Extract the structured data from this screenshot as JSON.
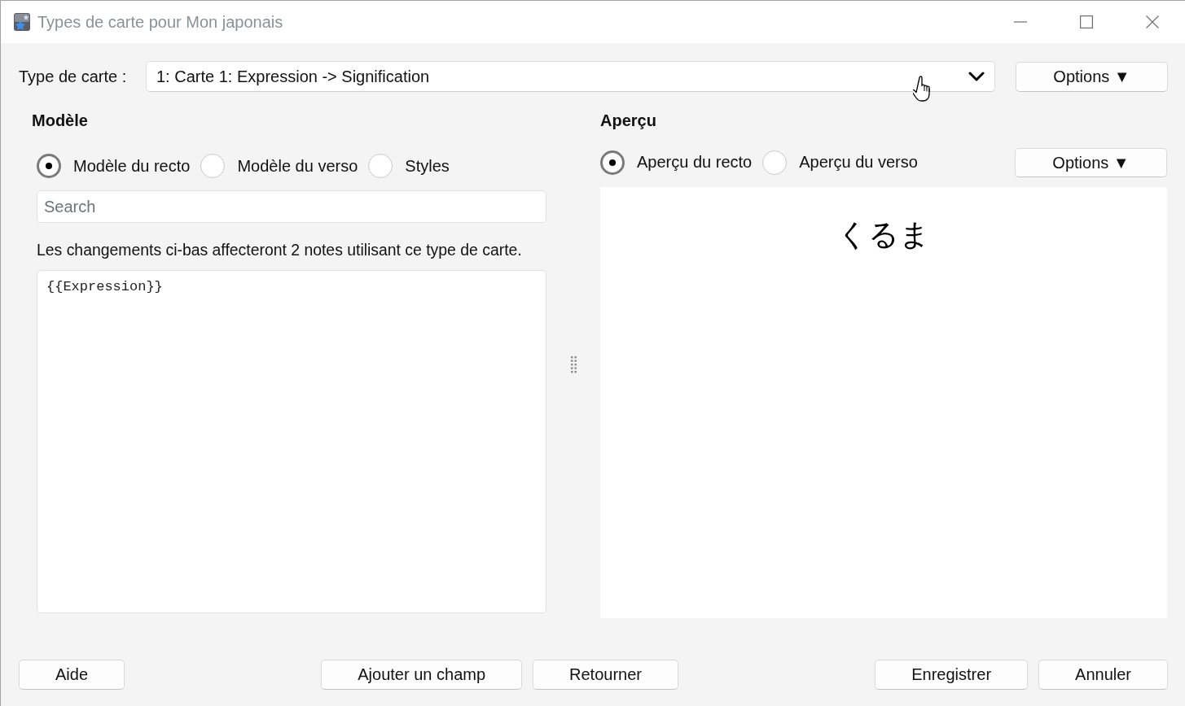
{
  "window": {
    "title": "Types de carte pour Mon japonais"
  },
  "card_type": {
    "label": "Type de carte :",
    "value": "1: Carte 1: Expression -> Signification",
    "options_button": "Options ▼"
  },
  "template": {
    "heading": "Modèle",
    "radios": [
      {
        "label": "Modèle du recto",
        "selected": true
      },
      {
        "label": "Modèle du verso",
        "selected": false
      },
      {
        "label": "Styles",
        "selected": false
      }
    ],
    "search": {
      "placeholder": "Search"
    },
    "info": "Les changements ci-bas affecteront 2 notes utilisant ce type de carte.",
    "editor": {
      "value": "{{Expression}}"
    }
  },
  "preview": {
    "heading": "Aperçu",
    "radios": [
      {
        "label": "Aperçu du recto",
        "selected": true
      },
      {
        "label": "Aperçu du verso",
        "selected": false
      }
    ],
    "options_button": "Options ▼",
    "card_text": "くるま"
  },
  "footer_button_groups": [
    [
      "Aide"
    ],
    [
      "Ajouter un champ",
      "Retourner"
    ],
    [
      "Enregistrer",
      "Annuler"
    ]
  ]
}
